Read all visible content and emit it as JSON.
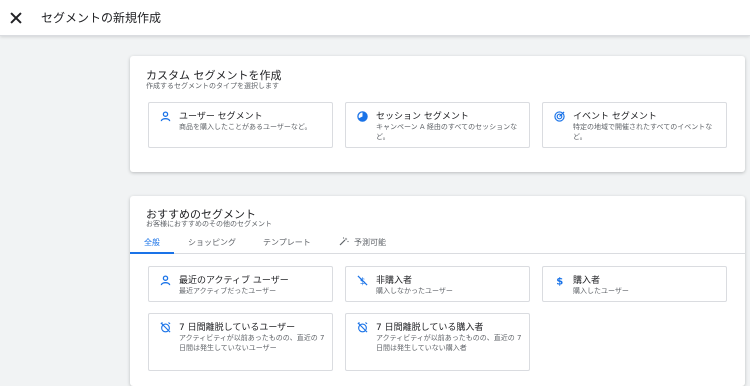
{
  "header": {
    "title": "セグメントの新規作成"
  },
  "custom": {
    "title": "カスタム セグメントを作成",
    "subtitle": "作成するセグメントのタイプを選択します",
    "tiles": [
      {
        "icon": "person-icon",
        "title": "ユーザー セグメント",
        "desc": "商品を購入したことがあるユーザーなど。"
      },
      {
        "icon": "session-icon",
        "title": "セッション セグメント",
        "desc": "キャンペーン A 経由のすべてのセッションなど。"
      },
      {
        "icon": "event-icon",
        "title": "イベント セグメント",
        "desc": "特定の地域で開催されたすべてのイベントなど。"
      }
    ]
  },
  "recommended": {
    "title": "おすすめのセグメント",
    "subtitle": "お客様におすすめのその他のセグメント",
    "tabs": [
      "全般",
      "ショッピング",
      "テンプレート",
      "予測可能"
    ],
    "active_tab": "全般",
    "tiles": [
      {
        "icon": "person-icon",
        "title": "最近のアクティブ ユーザー",
        "desc": "最近アクティブだったユーザー"
      },
      {
        "icon": "no-purchase-icon",
        "title": "非購入者",
        "desc": "購入しなかったユーザー"
      },
      {
        "icon": "dollar-icon",
        "title": "購入者",
        "desc": "購入したユーザー"
      },
      {
        "icon": "alarm-off-icon",
        "title": "7 日間離脱しているユーザー",
        "desc": "アクティビティが以前あったものの、直近の 7 日間は発生していないユーザー"
      },
      {
        "icon": "alarm-off-icon",
        "title": "7 日間離脱している購入者",
        "desc": "アクティビティが以前あったものの、直近の 7 日間は発生していない購入者"
      }
    ]
  },
  "colors": {
    "accent": "#1a73e8",
    "text": "#202124",
    "muted": "#5f6368",
    "border": "#dadce0",
    "background": "#f1f3f4"
  }
}
